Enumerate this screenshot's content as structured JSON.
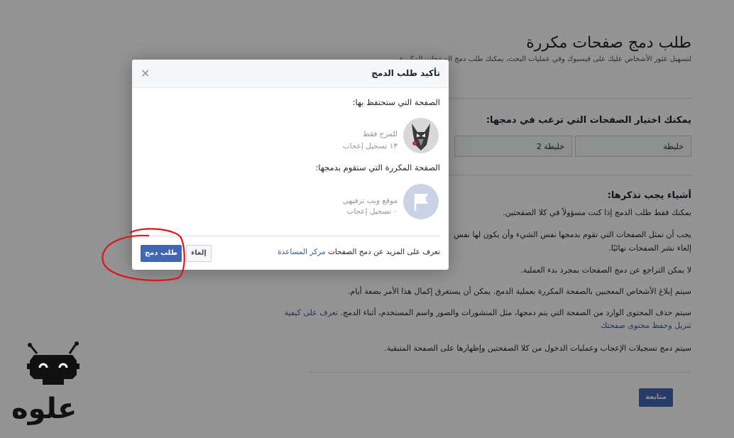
{
  "page": {
    "title": "طلب دمج صفحات مكررة",
    "subtitle": "لتسهيل عثور الأشخاص عليك على فيسبوك وفي عمليات البحث، يمكنك طلب دمج الصفحات المكررة",
    "select_title": "يمكنك اختيار الصفحات التي ترغب في دمجها:",
    "select_1": "خليطة",
    "select_2": "خليطة 2",
    "remember_title": "أشياء يجب تذكرها:",
    "b1": "يمكنك فقط طلب الدمج إذا كنت مسؤولاً في كلا الصفحتين.",
    "b2a": "يجب أن تمثل الصفحات التي تقوم بدمجها نفس الشيء وأن يكون لها نفس",
    "b2b": "إلغاء نشر الصفحات نهائيًا.",
    "b3": "لا يمكن التراجع عن دمج الصفحات بمجرد بدء العملية.",
    "b4": "سيتم إبلاغ الأشخاص المعجبين بالصفحة المكررة بعملية الدمج. يمكن أن يستغرق إكمال هذا الأمر بضعة أيام.",
    "b5a": "سيتم حذف المحتوى الوارد من الصفحة التي يتم دمجها، مثل المنشورات والصور واسم المستخدم، أثناء الدمج.",
    "b5link1": "تعرف على كيفية",
    "b5link2": "تنزيل وحفظ محتوى صفحتك",
    "b6": "سيتم دمج تسجيلات الإعجاب وعمليات الدخول من كلا الصفحتين وإظهارها على الصفحة المتبقية.",
    "continue": "متابعة"
  },
  "modal": {
    "title": "تأكيد طلب الدمج",
    "keep_label": "الصفحة التي ستحتفظ بها:",
    "keep_name": "للمرح فقط",
    "keep_likes": "١٣ تسجيل إعجاب",
    "merge_label": "الصفحة المكررة التي ستقوم بدمجها:",
    "merge_name": "موقع ويب ترفيهي",
    "merge_likes": "٠ تسجيل إعجاب",
    "footer_text": "تعرف على المزيد عن دمج الصفحات",
    "footer_link": "مركز المساعدة",
    "cancel": "إلغاء",
    "merge": "طلب دمج"
  },
  "colors": {
    "accent": "#4267b2",
    "annotation": "#e0141b"
  },
  "icons": {
    "close": "close-icon",
    "wolf": "wolf-avatar-icon",
    "flag": "flag-icon",
    "brand": "robot-logo-icon"
  },
  "brand": {
    "logo_text": "علوه"
  }
}
